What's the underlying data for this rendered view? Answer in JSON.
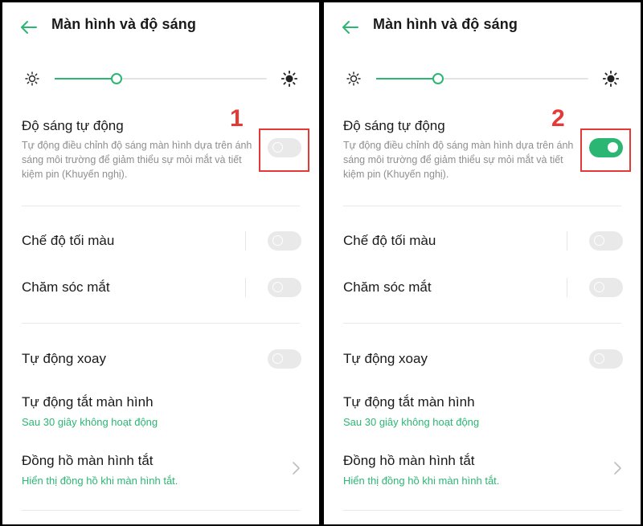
{
  "colors": {
    "accent": "#2bb673",
    "annotation": "#e53935",
    "toggle_off": "#e9e9e9"
  },
  "screens": [
    {
      "step_label": "1",
      "header": {
        "back_icon": "arrow-left-icon",
        "title": "Màn hình và độ sáng"
      },
      "brightness": {
        "low_icon": "sun-small-icon",
        "high_icon": "sun-large-icon",
        "level_percent": 29
      },
      "auto_brightness": {
        "title": "Độ sáng tự động",
        "description": "Tự động điều chỉnh độ sáng màn hình dựa trên ánh sáng môi trường để giảm thiểu sự mỏi mắt và tiết kiệm pin (Khuyến nghị).",
        "enabled": false
      },
      "dark_mode": {
        "title": "Chế độ tối màu",
        "enabled": false
      },
      "eye_care": {
        "title": "Chăm sóc mắt",
        "enabled": false
      },
      "auto_rotate": {
        "title": "Tự động xoay",
        "enabled": false
      },
      "screen_timeout": {
        "title": "Tự động tắt màn hình",
        "value": "Sau 30 giây không hoạt động"
      },
      "aod_clock": {
        "title": "Đồng hồ màn hình tắt",
        "value": "Hiển thị đồng hồ khi màn hình tắt.",
        "chevron_icon": "chevron-right-icon"
      }
    },
    {
      "step_label": "2",
      "header": {
        "back_icon": "arrow-left-icon",
        "title": "Màn hình và độ sáng"
      },
      "brightness": {
        "low_icon": "sun-small-icon",
        "high_icon": "sun-large-icon",
        "level_percent": 29
      },
      "auto_brightness": {
        "title": "Độ sáng tự động",
        "description": "Tự động điều chỉnh độ sáng màn hình dựa trên ánh sáng môi trường để giảm thiểu sự mỏi mắt và tiết kiệm pin (Khuyến nghị).",
        "enabled": true
      },
      "dark_mode": {
        "title": "Chế độ tối màu",
        "enabled": false
      },
      "eye_care": {
        "title": "Chăm sóc mắt",
        "enabled": false
      },
      "auto_rotate": {
        "title": "Tự động xoay",
        "enabled": false
      },
      "screen_timeout": {
        "title": "Tự động tắt màn hình",
        "value": "Sau 30 giây không hoạt động"
      },
      "aod_clock": {
        "title": "Đồng hồ màn hình tắt",
        "value": "Hiển thị đồng hồ khi màn hình tắt.",
        "chevron_icon": "chevron-right-icon"
      }
    }
  ]
}
